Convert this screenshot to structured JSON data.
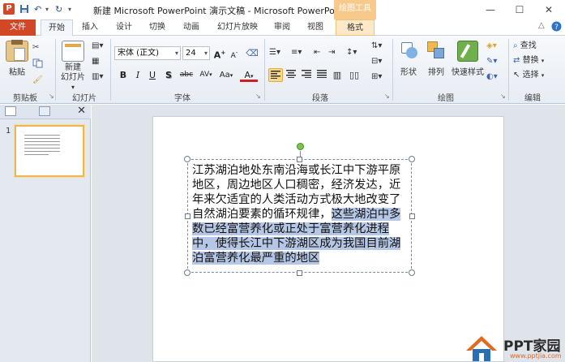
{
  "title": {
    "document": "新建 Microsoft PowerPoint 演示文稿 - Microsoft PowerPoint",
    "context_tab_group": "绘图工具",
    "app_icon_letter": "P"
  },
  "window_buttons": {
    "minimize": "—",
    "maximize": "☐",
    "close": "✕"
  },
  "tabs": {
    "file": "文件",
    "home": "开始",
    "insert": "插入",
    "design": "设计",
    "transitions": "切换",
    "animations": "动画",
    "slideshow": "幻灯片放映",
    "review": "审阅",
    "view": "视图",
    "format": "格式"
  },
  "ribbon": {
    "clipboard": {
      "paste": "粘贴",
      "label": "剪贴板"
    },
    "slides": {
      "new_slide_line1": "新建",
      "new_slide_line2": "幻灯片",
      "label": "幻灯片"
    },
    "font": {
      "name": "宋体 (正文)",
      "size": "24",
      "grow": "A",
      "shrink": "A",
      "bold": "B",
      "italic": "I",
      "underline": "U",
      "shadow": "S",
      "strike": "abc",
      "spacing": "AV",
      "case": "Aa",
      "color": "A",
      "label": "字体"
    },
    "paragraph": {
      "label": "段落"
    },
    "drawing": {
      "shapes": "形状",
      "arrange": "排列",
      "quick_styles": "快速样式",
      "label": "绘图"
    },
    "editing": {
      "find": "查找",
      "replace": "替换",
      "select": "选择",
      "label": "编辑"
    }
  },
  "slide_pane": {
    "slide_number": "1"
  },
  "slide": {
    "text_plain": "江苏湖泊地处东南沿海或长江中下游平原地区，周边地区人口稠密，经济发达，近年来欠适宜的人类活动方式极大地改变了自然湖泊要素的循环规律，",
    "text_selected": "这些湖泊中多数已经富营养化或正处于富营养化进程中，使得长江中下游湖区成为我国目前湖泊富营养化最严重的地区"
  },
  "watermark": {
    "text": "PPT家园",
    "url": "www.pptjia.com"
  },
  "colors": {
    "file_tab": "#d24726",
    "context_tab": "#f7c98a",
    "selection": "#b6c7e6",
    "accent": "#2b5797"
  }
}
